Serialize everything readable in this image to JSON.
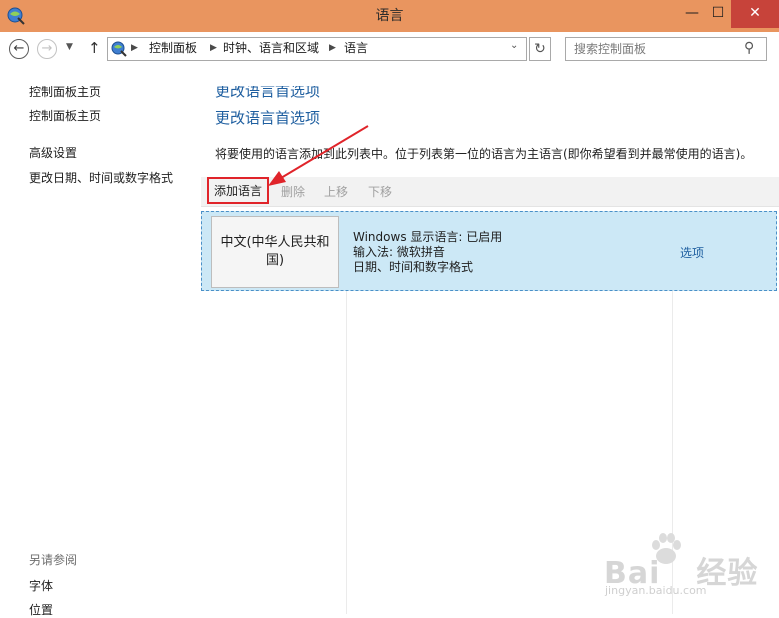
{
  "window": {
    "title": "语言",
    "minimize": "—",
    "maximize": "☐",
    "close": "✕"
  },
  "nav": {
    "back": "←",
    "forward": "→",
    "recent": "▼",
    "up": "↑",
    "breadcrumbs": [
      "控制面板",
      "时钟、语言和区域",
      "语言"
    ],
    "separator": "▶",
    "dropdown": "⌄",
    "refresh": "↻",
    "search_placeholder": "搜索控制面板",
    "search_glyph": "⚲"
  },
  "sidebar": {
    "partial_top": "控制面板主页",
    "items": [
      "控制面板主页",
      "高级设置",
      "更改日期、时间或数字格式"
    ],
    "see_also_title": "另请参阅",
    "see_also": [
      "字体",
      "位置"
    ]
  },
  "main": {
    "partial_heading": "更改语言首选项",
    "heading": "更改语言首选项",
    "description": "将要使用的语言添加到此列表中。位于列表第一位的语言为主语言(即你希望看到并最常使用的语言)。",
    "toolbar": {
      "add": "添加语言",
      "remove": "删除",
      "move_up": "上移",
      "move_down": "下移"
    },
    "languages": [
      {
        "name": "中文(中华人民共和国)",
        "details": [
          "Windows 显示语言: 已启用",
          "输入法: 微软拼音",
          "日期、时间和数字格式"
        ],
        "options": "选项"
      }
    ]
  },
  "watermark": {
    "brand_left": "Bai",
    "brand_right": "经验",
    "url": "jingyan.baidu.com"
  },
  "colors": {
    "titlebar": "#e9955f",
    "close": "#c7433a",
    "link": "#1f5fa0",
    "selected_row": "#cce8f6",
    "highlight_box": "#e0242a"
  }
}
